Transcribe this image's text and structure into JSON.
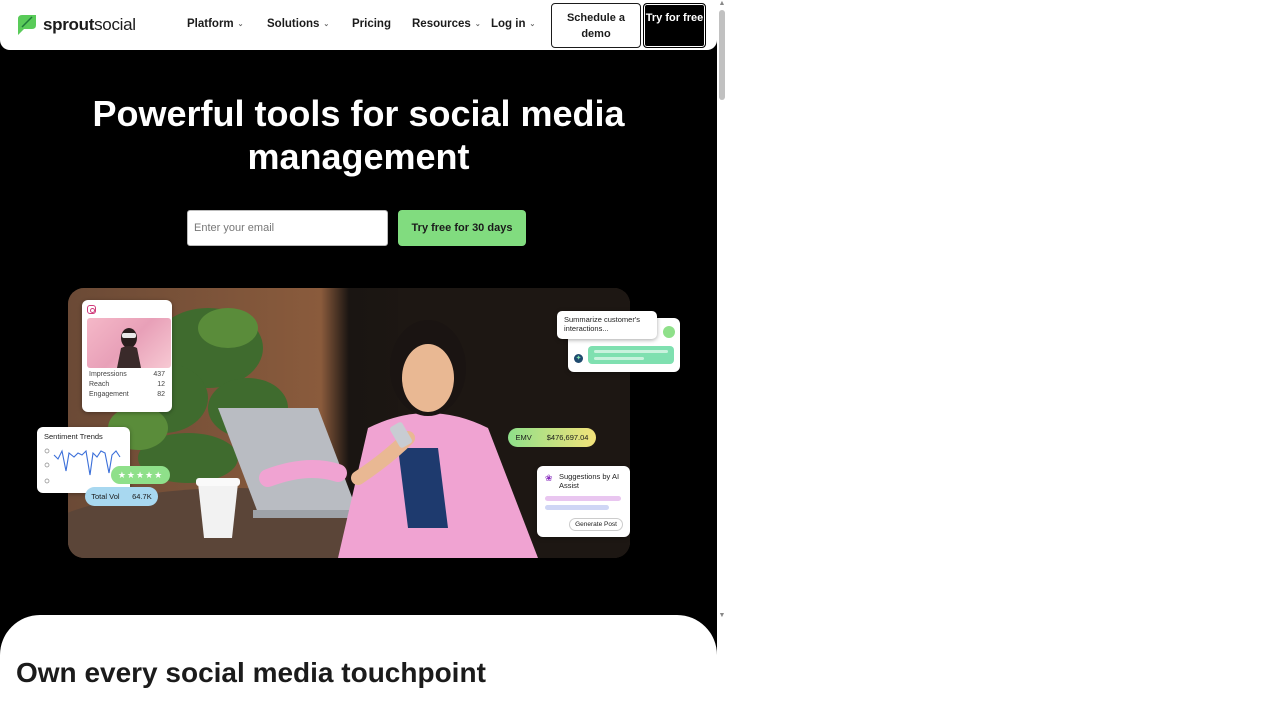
{
  "brand": {
    "name_bold": "sprout",
    "name_light": "social",
    "green": "#59cb59"
  },
  "nav": {
    "items": [
      {
        "label": "Platform",
        "has_dropdown": true
      },
      {
        "label": "Solutions",
        "has_dropdown": true
      },
      {
        "label": "Pricing",
        "has_dropdown": false
      },
      {
        "label": "Resources",
        "has_dropdown": true
      },
      {
        "label": "Log in",
        "has_dropdown": true
      }
    ],
    "schedule_demo": "Schedule a demo",
    "try_free": "Try for free"
  },
  "hero": {
    "title": "Powerful tools for social media management",
    "email_placeholder": "Enter your email",
    "cta": "Try free for 30 days"
  },
  "cards": {
    "instagram": {
      "icon": "instagram-icon",
      "stats": [
        {
          "label": "Impressions",
          "value": "437"
        },
        {
          "label": "Reach",
          "value": "12"
        },
        {
          "label": "Engagement",
          "value": "82"
        }
      ]
    },
    "sentiment": {
      "title": "Sentiment Trends",
      "stars": "★★★★★",
      "total_label": "Total Vol",
      "total_value": "64.7K"
    },
    "summarize": {
      "text": "Summarize customer's interactions..."
    },
    "emv": {
      "label": "EMV",
      "value": "$476,697.04"
    },
    "suggestions": {
      "title": "Suggestions by AI Assist",
      "button": "Generate Post"
    }
  },
  "section2": {
    "title": "Own every social media touchpoint"
  },
  "colors": {
    "cta_green": "#81dc7f",
    "hero_bg": "#000000"
  }
}
